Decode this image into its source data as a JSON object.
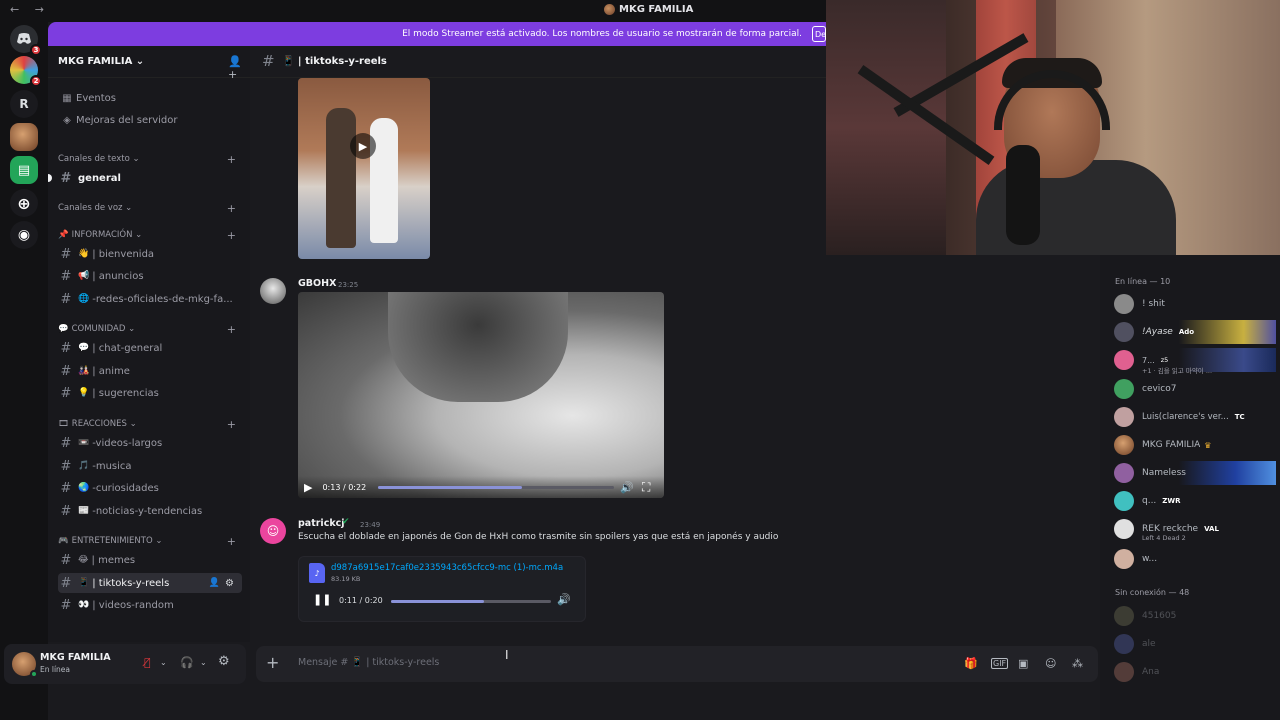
{
  "titlebar": {
    "server_title": "MKG FAMILIA",
    "nav": "← →"
  },
  "rail": {
    "badges": [
      "3",
      "2"
    ],
    "letter_icon": "R"
  },
  "banner": {
    "text": "El modo Streamer está activado. Los nombres de usuario se mostrarán de forma parcial.",
    "button": "De"
  },
  "server": {
    "name": "MKG FAMILIA"
  },
  "sidebar": {
    "top_items": [
      {
        "label": "Eventos",
        "icon": "calendar-icon"
      },
      {
        "label": "Mejoras del servidor",
        "icon": "boost-icon"
      }
    ],
    "categories": {
      "texto": "Canales de texto",
      "voz": "Canales de voz",
      "informacion": "INFORMACIÓN",
      "comunidad": "COMUNIDAD",
      "reacciones": "REACCIONES",
      "entretenimiento": "ENTRETENIMIENTO"
    },
    "channels": {
      "general": "general",
      "bienvenida": "bienvenida",
      "anuncios": "anuncios",
      "redes": "-redes-oficiales-de-mkg-fa...",
      "chat_general": "chat-general",
      "anime": "anime",
      "sugerencias": "sugerencias",
      "videos_largos": "-videos-largos",
      "musica": "-musica",
      "curiosidades": "-curiosidades",
      "noticias": "-noticias-y-tendencias",
      "memes": "memes",
      "tiktoks": "tiktoks-y-reels",
      "videos_random": "videos-random"
    }
  },
  "user": {
    "name": "MKG FAMILIA",
    "status": "En línea"
  },
  "channel_header": {
    "name": "tiktoks-y-reels"
  },
  "messages": [
    {
      "author": "GBOHX",
      "time": "23:25",
      "video": {
        "time": "0:13 / 0:22",
        "progress": 0.61
      }
    },
    {
      "author": "patrickcj",
      "time": "23:49",
      "text": "Escucha el doblade en japonés de Gon de HxH como trasmite sin spoilers yas que está en japonés y audio",
      "attachment": {
        "filename": "d987a6915e17caf0e2335943c65cfcc9-mc (1)-mc.m4a",
        "size": "83.19 KB",
        "time": "0:11 / 0:20",
        "progress": 0.58
      }
    }
  ],
  "composer": {
    "placeholder": "Mensaje #",
    "channel": "| tiktoks-y-reels"
  },
  "members": {
    "online_header": "En línea — 10",
    "online": [
      {
        "name": "! shit"
      },
      {
        "name": "!Ayase",
        "tag": "Ado"
      },
      {
        "name": "7...",
        "tag": "z5",
        "sub": "+1 · 김을 읽고 마약이 ..."
      },
      {
        "name": "cevico7"
      },
      {
        "name": "Luis(clarence's ver...",
        "tag": "TC"
      },
      {
        "name": "MKG FAMILIA"
      },
      {
        "name": "Nameless"
      },
      {
        "name": "q...",
        "tag": "ZWR"
      },
      {
        "name": "REK reckche",
        "tag": "VAL",
        "sub": "Left 4 Dead 2"
      },
      {
        "name": "w..."
      }
    ],
    "offline_header": "Sin conexión — 48",
    "offline": [
      {
        "name": "451605"
      },
      {
        "name": "ale"
      },
      {
        "name": "Ana"
      }
    ]
  }
}
